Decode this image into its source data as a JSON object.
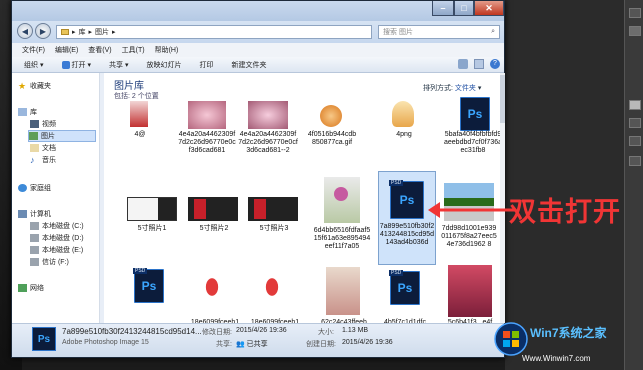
{
  "window": {
    "address": [
      "库",
      "图片"
    ],
    "search_placeholder": "搜索 图片",
    "menu": [
      "文件(F)",
      "编辑(E)",
      "查看(V)",
      "工具(T)",
      "帮助(H)"
    ],
    "toolbar": [
      "组织",
      "打开",
      "共享",
      "放映幻灯片",
      "打印",
      "新建文件夹"
    ]
  },
  "nav": {
    "favorites": "收藏夹",
    "libraries": "库",
    "lib_items": [
      "视频",
      "图片",
      "文档",
      "音乐"
    ],
    "homegroup": "家庭组",
    "computer": "计算机",
    "drives": [
      "本地磁盘 (C:)",
      "本地磁盘 (D:)",
      "本地磁盘 (E:)",
      "信访 (F:)"
    ],
    "network": "网络"
  },
  "library": {
    "title": "图片库",
    "subtitle": "包括: 2 个位置",
    "arrange_label": "排列方式:",
    "arrange_value": "文件夹"
  },
  "files": {
    "row1": [
      "4@",
      "4e4a20a4462309f7d2c26d96770e0cf3d6cad681",
      "4e4a20a4462309f7d2c26d96770e0cf3d6cad681--2",
      "4f0516b944cdb850877ca.gif",
      "4png",
      "5bafa40f4bfbfbfd9aeebdbd7cf0f736aec31fb8"
    ],
    "row2": [
      "5寸照片1",
      "5寸照片2",
      "5寸照片3",
      "6d4bb6516fdfaaf515f61a63e895494eef11f7a05",
      "7a899e510fb30f2413244815cd95d143ad4b036d",
      "7dd98d1001e939011675f8a27eec54e736d1962 8"
    ],
    "row3": [
      "",
      "18e6099fceeh1",
      "18e6099fceeh1",
      "62c24c43ffeeh",
      "4b5f7c1d1dfc",
      "5c6b41f3...e4f"
    ]
  },
  "details": {
    "filename": "7a899e510fb30f2413244815cd95d14...",
    "type": "Adobe Photoshop Image 15",
    "modified_label": "修改日期:",
    "modified": "2015/4/26 19:36",
    "shared_label": "共享:",
    "shared": "已共享",
    "size_label": "大小:",
    "size": "1.13 MB",
    "created_label": "创建日期:",
    "created": "2015/4/26 19:36"
  },
  "annotation": "双击打开",
  "watermark": {
    "brand": "Win7系统之家",
    "url": "Www.Winwin7.com"
  }
}
